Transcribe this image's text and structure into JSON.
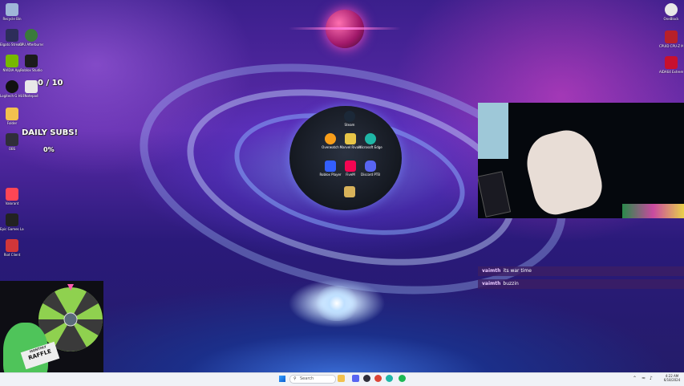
{
  "desktop_icons_left": [
    {
      "label": "Recycle Bin",
      "icon": "recycle-bin-icon",
      "color": "#9fb6d8"
    },
    {
      "label": "Elgato Stream Deck",
      "icon": "stream-deck-icon",
      "color": "#2d2d5a"
    },
    {
      "label": "CPU Afterburner",
      "icon": "afterburner-icon",
      "color": "#3a7a3a"
    },
    {
      "label": "NVIDIA App",
      "icon": "nvidia-icon",
      "color": "#76b900"
    },
    {
      "label": "Roblox Studio",
      "icon": "roblox-studio-icon",
      "color": "#1c1c1c"
    },
    {
      "label": "Logitech G HUB",
      "icon": "logitech-icon",
      "color": "#111111"
    },
    {
      "label": "Notepad",
      "icon": "notepad-icon",
      "color": "#e8e8e8"
    },
    {
      "label": "Folder",
      "icon": "folder-icon",
      "color": "#f2c14e"
    },
    {
      "label": "OBS",
      "icon": "obs-icon",
      "color": "#302e3a"
    },
    {
      "label": "Valorant",
      "icon": "valorant-icon",
      "color": "#ff4655"
    },
    {
      "label": "Epic Games Launcher",
      "icon": "epic-games-icon",
      "color": "#222222"
    },
    {
      "label": "Riot Client",
      "icon": "riot-icon",
      "color": "#d13639"
    }
  ],
  "desktop_icons_right": [
    {
      "label": "OneBlock",
      "icon": "oneblock-icon",
      "color": "#e8e8e8"
    },
    {
      "label": "CPUID CPU-Z MSI",
      "icon": "cpuz-icon",
      "color": "#b8202a"
    },
    {
      "label": "AIDA64 Extreme",
      "icon": "aida64-icon",
      "color": "#c8102e"
    }
  ],
  "overlay": {
    "sub_counter": "0 / 10",
    "daily_subs_label": "DAILY SUBS!",
    "daily_subs_percent": "0%"
  },
  "orb_apps": [
    {
      "label": "Steam",
      "icon": "steam-icon",
      "color": "#1b2838"
    },
    {
      "label": "Overwatch",
      "icon": "overwatch-icon",
      "color": "#f99e1a"
    },
    {
      "label": "Marvel Rivals",
      "icon": "marvel-rivals-icon",
      "color": "#e8c547"
    },
    {
      "label": "Microsoft Edge",
      "icon": "edge-icon",
      "color": "#1fb6a6"
    },
    {
      "label": "Roblox Player",
      "icon": "roblox-icon",
      "color": "#335fff"
    },
    {
      "label": "FiveM",
      "icon": "fivem-icon",
      "color": "#f40552"
    },
    {
      "label": "Discord PTB",
      "icon": "discord-icon",
      "color": "#5865f2"
    },
    {
      "label": "",
      "icon": "shortcut-icon",
      "color": "#d8b25a"
    }
  ],
  "chat": [
    {
      "user": "vaimth",
      "message": "its war time"
    },
    {
      "user": "vaimth",
      "message": "buzzin"
    }
  ],
  "raffle": {
    "label": "RAFFLE",
    "sublabel": "MONTHLY"
  },
  "taskbar": {
    "search_placeholder": "Search",
    "time": "4:22 AM",
    "date": "6/18/2024",
    "apps": [
      {
        "icon": "file-explorer-icon",
        "color": "#f2c14e"
      },
      {
        "icon": "discord-taskbar-icon",
        "color": "#5865f2"
      },
      {
        "icon": "obs-taskbar-icon",
        "color": "#302e3a"
      },
      {
        "icon": "chrome-icon",
        "color": "#db4437"
      },
      {
        "icon": "edge-taskbar-icon",
        "color": "#1fb6a6"
      },
      {
        "icon": "spotify-icon",
        "color": "#1db954"
      }
    ]
  }
}
